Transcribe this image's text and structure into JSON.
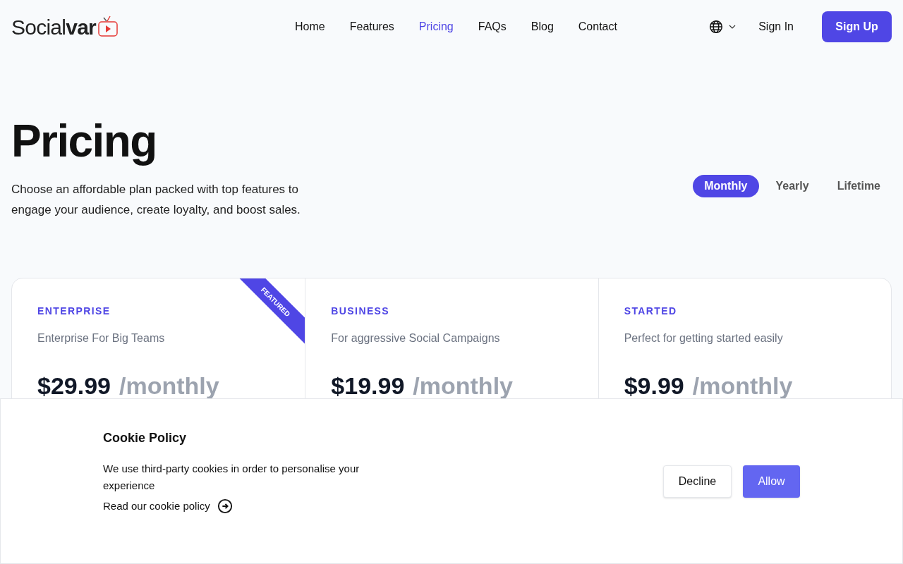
{
  "logo": {
    "text": "Social**var**"
  },
  "nav": [
    {
      "label": "Home",
      "selected": false
    },
    {
      "label": "Features",
      "selected": false
    },
    {
      "label": "Pricing",
      "selected": true
    },
    {
      "label": "FAQs",
      "selected": false
    },
    {
      "label": "Blog",
      "selected": false
    },
    {
      "label": "Contact",
      "selected": false
    }
  ],
  "header_actions": {
    "sign_in": "Sign In",
    "sign_up": "Sign Up"
  },
  "hero": {
    "title": "Pricing",
    "subtitle": "Choose an affordable plan packed with top features to engage your audience, create loyalty, and boost sales."
  },
  "billing": [
    {
      "label": "Monthly",
      "selected": true
    },
    {
      "label": "Yearly",
      "selected": false
    },
    {
      "label": "Lifetime",
      "selected": false
    }
  ],
  "plans": [
    {
      "name": "ENTERPRISE",
      "description": "Enterprise For Big Teams",
      "price": "$29.99",
      "period": "/monthly",
      "featured": true,
      "ribbon": "FEATURED"
    },
    {
      "name": "BUSINESS",
      "description": "For aggressive Social Campaigns",
      "price": "$19.99",
      "period": "/monthly",
      "featured": false
    },
    {
      "name": "STARTED",
      "description": "Perfect for getting started easily",
      "price": "$9.99",
      "period": "/monthly",
      "featured": false
    }
  ],
  "cookie_banner": {
    "title": "Cookie Policy",
    "text": "We use third-party cookies in order to personalise your experience",
    "link": "Read our cookie policy",
    "decline": "Decline",
    "allow": "Allow"
  }
}
